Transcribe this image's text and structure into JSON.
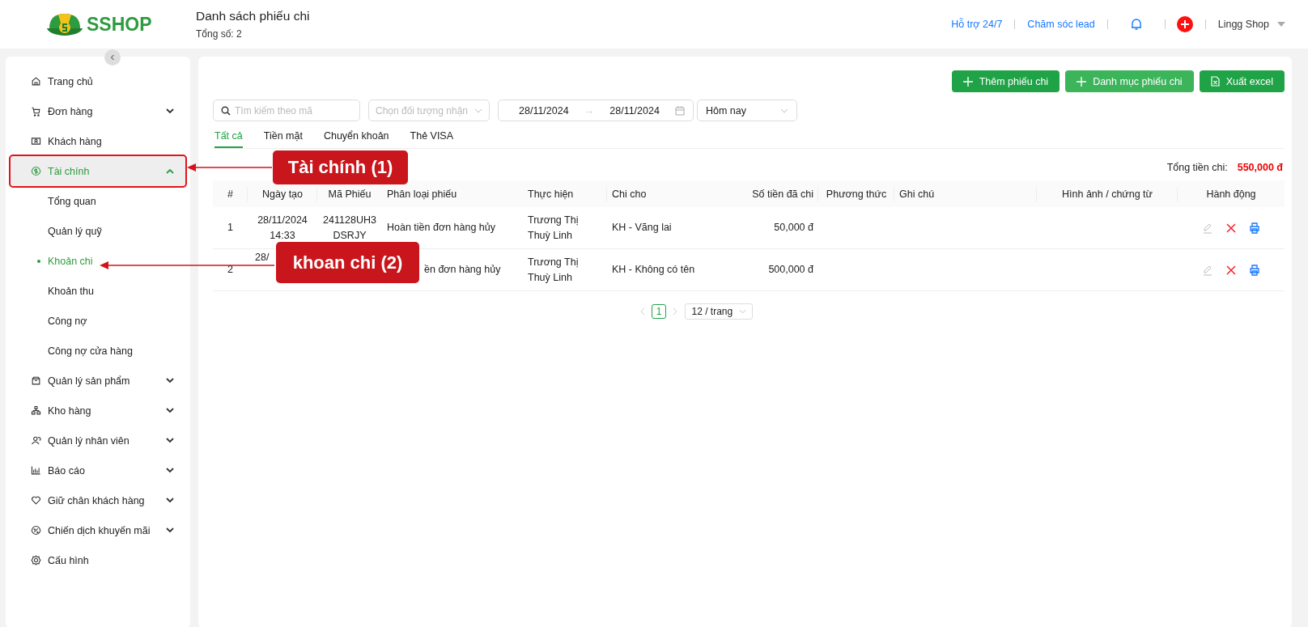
{
  "header": {
    "logo": "SSHOP",
    "title": "Danh sách phiếu chi",
    "subtitle": "Tổng số: 2",
    "links": [
      "Hỗ trợ 24/7",
      "Chăm sóc lead"
    ],
    "user": "Lingg Shop"
  },
  "sidebar": {
    "items": [
      {
        "label": "Trang chủ",
        "selected": false
      },
      {
        "label": "Đơn hàng",
        "selected": false,
        "expanded": false
      },
      {
        "label": "Khách hàng",
        "selected": false
      },
      {
        "label": "Tài chính",
        "selected": true,
        "highlighted": true,
        "expanded": true,
        "children": [
          {
            "label": "Tổng quan",
            "selected": false
          },
          {
            "label": "Quản lý quỹ",
            "selected": false
          },
          {
            "label": "Khoản chi",
            "selected": true
          },
          {
            "label": "Khoản thu",
            "selected": false
          },
          {
            "label": "Công nợ",
            "selected": false
          },
          {
            "label": "Công nợ cửa hàng",
            "selected": false
          }
        ]
      },
      {
        "label": "Quản lý sản phẩm",
        "selected": false,
        "expanded": false
      },
      {
        "label": "Kho hàng",
        "selected": false,
        "expanded": false
      },
      {
        "label": "Quản lý nhân viên",
        "selected": false,
        "expanded": false
      },
      {
        "label": "Báo cáo",
        "selected": false,
        "expanded": false
      },
      {
        "label": "Giữ chân khách hàng",
        "selected": false,
        "expanded": false
      },
      {
        "label": "Chiến dịch khuyến mãi",
        "selected": false,
        "expanded": false
      },
      {
        "label": "Cấu hình",
        "selected": false
      }
    ]
  },
  "actions": [
    "Thêm phiếu chi",
    "Danh mục phiếu chi",
    "Xuất excel"
  ],
  "filters": {
    "search": {
      "placeholder": "Tìm kiếm theo mã"
    },
    "recipient": {
      "placeholder": "Chọn đối tượng nhận"
    },
    "date_from": "28/11/2024",
    "date_separator": "→",
    "date_to": "28/11/2024",
    "period": "Hôm nay"
  },
  "tabs": [
    {
      "label": "Tất cả",
      "selected": true
    },
    {
      "label": "Tiền mặt",
      "selected": false
    },
    {
      "label": "Chuyển khoản",
      "selected": false
    },
    {
      "label": "Thẻ VISA",
      "selected": false
    }
  ],
  "total": {
    "label": "Tổng tiền chi:",
    "value": "550,000 đ"
  },
  "table": {
    "columns": [
      "#",
      "Ngày tạo",
      "Mã Phiếu",
      "Phân loại phiếu",
      "Thực hiện",
      "Chi cho",
      "Số tiền đã chi",
      "Phương thức",
      "Ghi chú",
      "Hình ảnh / chứng từ",
      "Hành động"
    ],
    "rows": [
      {
        "index": "1",
        "created": "28/11/2024 14:33",
        "code": "241128UH3 DSRJY",
        "type": "Hoàn tiền đơn hàng hủy",
        "by": "Trương Thị Thuỳ Linh",
        "payee": "KH - Vãng lai",
        "amount": "50,000 đ",
        "overlaid": false
      },
      {
        "index": "2",
        "created": "28/",
        "type": "ền đơn hàng hủy",
        "by": "Trương Thị Thuỳ Linh",
        "payee": "KH - Không có tên",
        "amount": "500,000 đ",
        "overlaid": true
      }
    ]
  },
  "pagination": {
    "pages": [
      {
        "label": "1",
        "selected": true
      }
    ],
    "page_size": "12 / trang"
  },
  "annotations": [
    {
      "label": "Tài chính (1)"
    },
    {
      "label": "khoan chi (2)"
    }
  ]
}
